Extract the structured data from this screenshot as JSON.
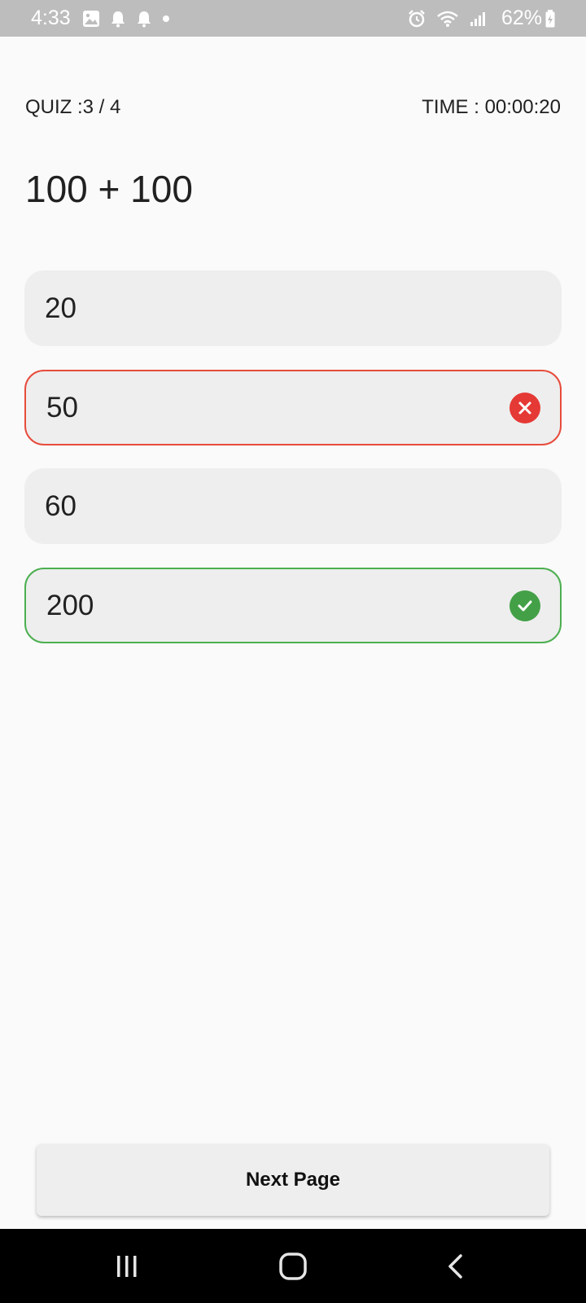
{
  "status_bar": {
    "time": "4:33",
    "left_icons": [
      "image-icon",
      "bell-icon",
      "bell-icon",
      "dot-icon"
    ],
    "right_icons": [
      "alarm-icon",
      "wifi-icon",
      "signal-icon"
    ],
    "battery": "62%",
    "icon_color": "#ffffff"
  },
  "quiz": {
    "counter": "QUIZ :3 / 4",
    "timer": "TIME : 00:00:20",
    "question": "100 + 100",
    "options": [
      {
        "label": "20",
        "state": "neutral"
      },
      {
        "label": "50",
        "state": "wrong"
      },
      {
        "label": "60",
        "state": "neutral"
      },
      {
        "label": "200",
        "state": "correct"
      }
    ]
  },
  "colors": {
    "wrong": "#e53935",
    "correct": "#43a047",
    "option_bg": "#eeeeee"
  },
  "actions": {
    "next_label": "Next Page"
  },
  "nav_bar": {
    "buttons": [
      "recents-icon",
      "home-icon",
      "back-icon"
    ]
  }
}
